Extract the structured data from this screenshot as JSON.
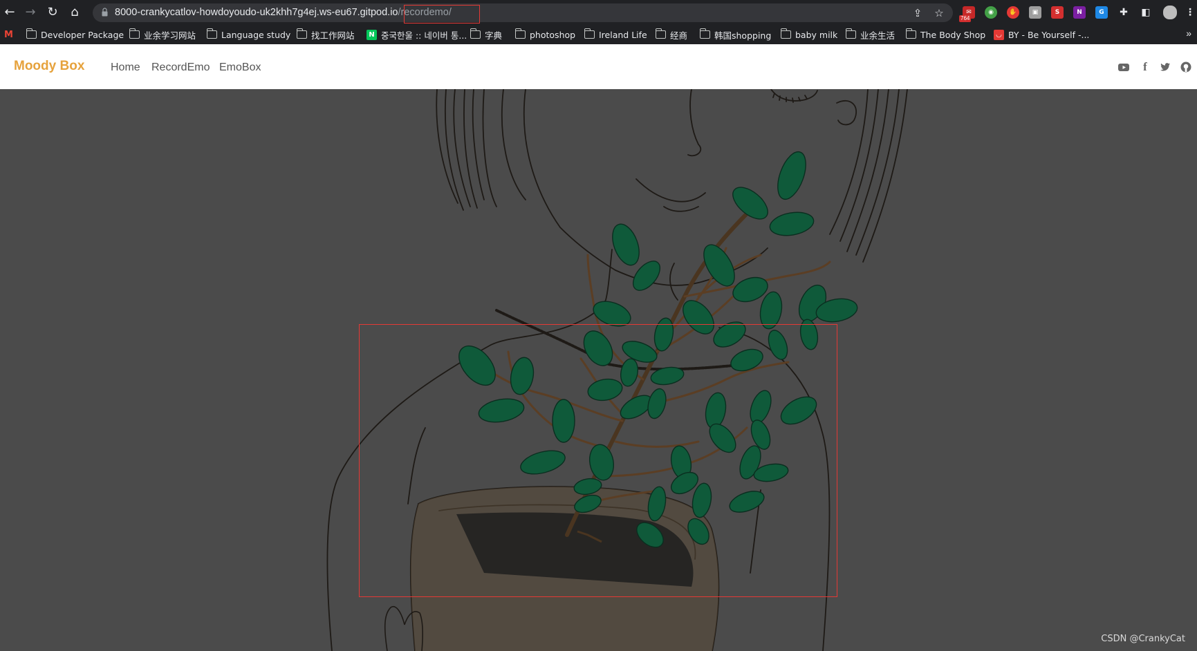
{
  "browser": {
    "nav": {
      "back_icon": "arrow-left",
      "forward_icon": "arrow-right",
      "reload_icon": "reload",
      "home_icon": "home"
    },
    "url_host": "8000-crankycatlov-howdoyoudo-uk2khh7g4ej.ws-eu67.gitpod.io",
    "url_path": "/recordemo/",
    "extension_badge": "764",
    "bookmarks": [
      {
        "label": "Developer Package",
        "type": "folder"
      },
      {
        "label": "业余学习网站",
        "type": "folder"
      },
      {
        "label": "Language study",
        "type": "folder"
      },
      {
        "label": "找工作网站",
        "type": "folder"
      },
      {
        "label": "중국한울 :: 네이버 통...",
        "type": "site"
      },
      {
        "label": "字典",
        "type": "folder"
      },
      {
        "label": "photoshop",
        "type": "folder"
      },
      {
        "label": "Ireland Life",
        "type": "folder"
      },
      {
        "label": "经商",
        "type": "folder"
      },
      {
        "label": "韩国shopping",
        "type": "folder"
      },
      {
        "label": "baby milk",
        "type": "folder"
      },
      {
        "label": "业余生活",
        "type": "folder"
      },
      {
        "label": "The Body Shop",
        "type": "folder"
      },
      {
        "label": "BY - Be Yourself -...",
        "type": "site"
      }
    ],
    "more_bookmarks": "»"
  },
  "site": {
    "brand": "Moody Box",
    "brand_color": "#e6a23c",
    "nav": [
      {
        "label": "Home"
      },
      {
        "label": "RecordEmo"
      },
      {
        "label": "EmoBox"
      }
    ],
    "social_icons": [
      "youtube-icon",
      "facebook-icon",
      "twitter-icon",
      "github-icon"
    ]
  },
  "watermark": "CSDN @CrankyCat",
  "colors": {
    "highlight": "#e53935",
    "overlay_bg": "#4b4b4b",
    "leaf": "#0f5a3a"
  }
}
